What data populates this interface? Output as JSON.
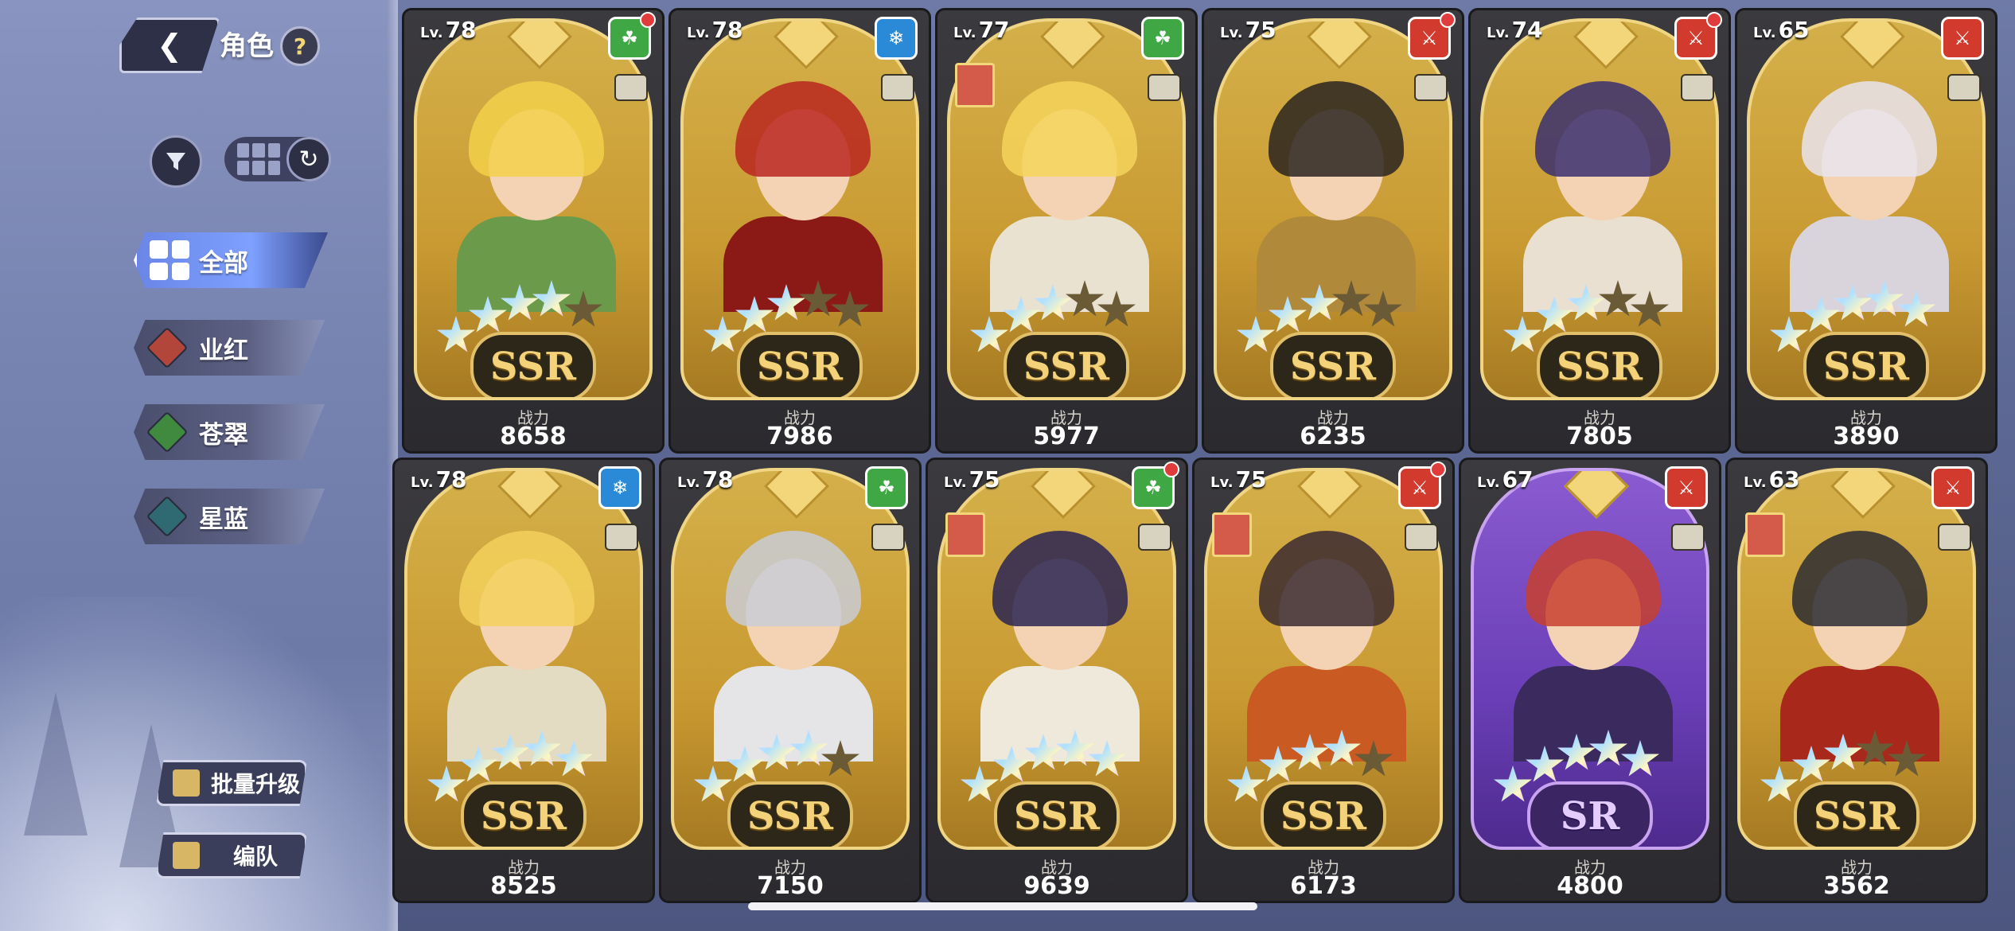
{
  "header": {
    "title": "角色",
    "help_label": "?",
    "back_icon": "back-arrow-icon"
  },
  "categories": [
    {
      "label": "全部",
      "active": true,
      "color": "#7ea0ff"
    },
    {
      "label": "业红",
      "active": false,
      "color": "#b3463b"
    },
    {
      "label": "苍翠",
      "active": false,
      "color": "#3f8a3f"
    },
    {
      "label": "星蓝",
      "active": false,
      "color": "#2f6a72"
    }
  ],
  "buttons": {
    "batch_upgrade": "批量升级",
    "team": "编队"
  },
  "power_label": "战力",
  "level_prefix": "Lv.",
  "characters": [
    {
      "level": "78",
      "power": "8658",
      "rarity": "SSR",
      "stars_lit": 4,
      "element": "green",
      "element_color": "#3fa845",
      "new": true,
      "hair": "#f2d04a",
      "outfit": "#6a9a4a",
      "guild": false
    },
    {
      "level": "78",
      "power": "7986",
      "rarity": "SSR",
      "stars_lit": 3,
      "element": "blue",
      "element_color": "#2a8ad8",
      "new": false,
      "hair": "#b8261e",
      "outfit": "#8b1a16",
      "guild": false
    },
    {
      "level": "77",
      "power": "5977",
      "rarity": "SSR",
      "stars_lit": 3,
      "element": "green",
      "element_color": "#3fa845",
      "new": false,
      "hair": "#f5d35a",
      "outfit": "#e9e2d0",
      "guild": true
    },
    {
      "level": "75",
      "power": "6235",
      "rarity": "SSR",
      "stars_lit": 3,
      "element": "red",
      "element_color": "#d33a2e",
      "new": true,
      "hair": "#2a2420",
      "outfit": "#b08a3a",
      "guild": false
    },
    {
      "level": "74",
      "power": "7805",
      "rarity": "SSR",
      "stars_lit": 3,
      "element": "red",
      "element_color": "#d33a2e",
      "new": true,
      "hair": "#3a2f6e",
      "outfit": "#e9e0d2",
      "guild": false
    },
    {
      "level": "65",
      "power": "3890",
      "rarity": "SSR",
      "stars_lit": 5,
      "element": "red",
      "element_color": "#d33a2e",
      "new": false,
      "hair": "#e9e4ee",
      "outfit": "#d9d4dc",
      "guild": false
    },
    {
      "level": "78",
      "power": "8525",
      "rarity": "SSR",
      "stars_lit": 5,
      "element": "blue",
      "element_color": "#2a8ad8",
      "new": false,
      "hair": "#f3d05c",
      "outfit": "#e3dcc2",
      "guild": false
    },
    {
      "level": "78",
      "power": "7150",
      "rarity": "SSR",
      "stars_lit": 4,
      "element": "green",
      "element_color": "#3fa845",
      "new": false,
      "hair": "#c9ccd6",
      "outfit": "#e5e5e8",
      "guild": false
    },
    {
      "level": "75",
      "power": "9639",
      "rarity": "SSR",
      "stars_lit": 5,
      "element": "green",
      "element_color": "#3fa845",
      "new": true,
      "hair": "#2a2452",
      "outfit": "#efe9dc",
      "guild": true
    },
    {
      "level": "75",
      "power": "6173",
      "rarity": "SSR",
      "stars_lit": 4,
      "element": "red",
      "element_color": "#d33a2e",
      "new": true,
      "hair": "#3b2a30",
      "outfit": "#c95a22",
      "guild": true
    },
    {
      "level": "67",
      "power": "4800",
      "rarity": "SR",
      "stars_lit": 5,
      "element": "red",
      "element_color": "#d33a2e",
      "new": false,
      "hair": "#c7402e",
      "outfit": "#3a2a5e",
      "guild": false
    },
    {
      "level": "63",
      "power": "3562",
      "rarity": "SSR",
      "stars_lit": 3,
      "element": "red",
      "element_color": "#d33a2e",
      "new": false,
      "hair": "#2b2b33",
      "outfit": "#a8281c",
      "guild": true
    }
  ]
}
